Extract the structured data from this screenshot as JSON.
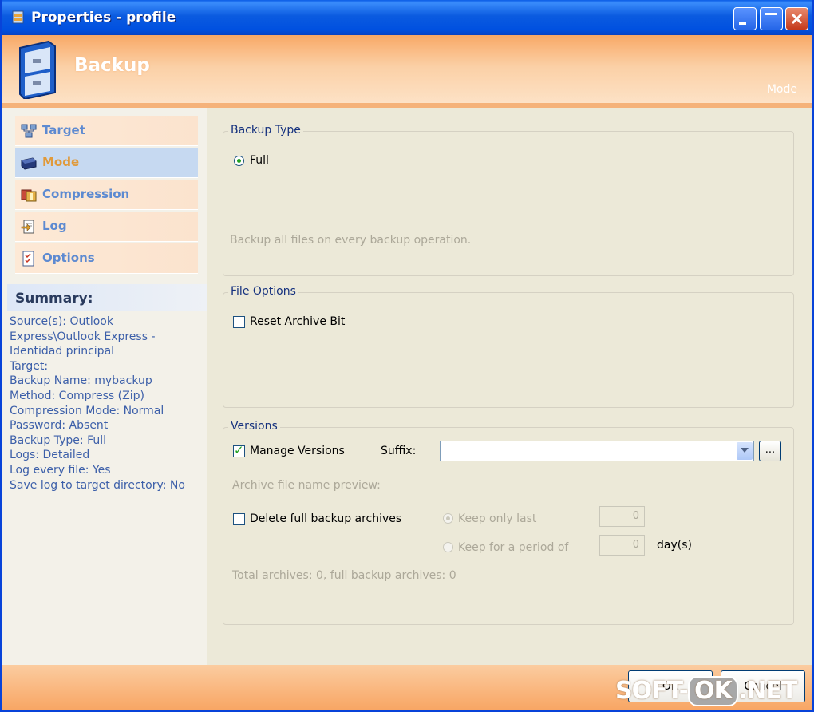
{
  "window": {
    "title": "Properties - profile"
  },
  "header": {
    "title": "Backup",
    "subtitle": "Mode"
  },
  "nav": {
    "items": [
      {
        "label": "Target",
        "icon": "network-icon"
      },
      {
        "label": "Mode",
        "icon": "drive-icon"
      },
      {
        "label": "Compression",
        "icon": "compression-icon"
      },
      {
        "label": "Log",
        "icon": "log-icon"
      },
      {
        "label": "Options",
        "icon": "checklist-icon"
      }
    ],
    "selected": "Mode"
  },
  "summary": {
    "heading": "Summary:",
    "lines": [
      "Source(s): Outlook",
      "Express\\Outlook Express -",
      "Identidad principal",
      "Target:",
      "Backup Name: mybackup",
      "Method: Compress (Zip)",
      "Compression Mode: Normal",
      "Password: Absent",
      "Backup Type: Full",
      "Logs: Detailed",
      "Log every file: Yes",
      "Save log to target directory: No"
    ]
  },
  "backup_type": {
    "group_title": "Backup Type",
    "option_full": "Full",
    "description": "Backup all files on every backup operation."
  },
  "file_options": {
    "group_title": "File Options",
    "reset_archive_bit": "Reset Archive Bit"
  },
  "versions": {
    "group_title": "Versions",
    "manage_versions": "Manage Versions",
    "suffix_label": "Suffix:",
    "suffix_value": "",
    "browse_label": "...",
    "preview_label": "Archive file name preview:",
    "delete_full": "Delete full backup archives",
    "keep_only_last": "Keep only last",
    "keep_only_last_value": "0",
    "keep_period": "Keep for a period of",
    "keep_period_value": "0",
    "days_label": "day(s)",
    "totals": "Total archives: 0, full backup archives: 0"
  },
  "buttons": {
    "ok": "OK",
    "cancel": "Cancel"
  },
  "watermark": {
    "left": "SOFT-",
    "mid": "OK",
    "right": ".NET"
  },
  "colors": {
    "title_bar": "#0a5ce6",
    "header": "#f8a866",
    "selected_nav": "#c6d9f1",
    "check": "#21a121"
  }
}
